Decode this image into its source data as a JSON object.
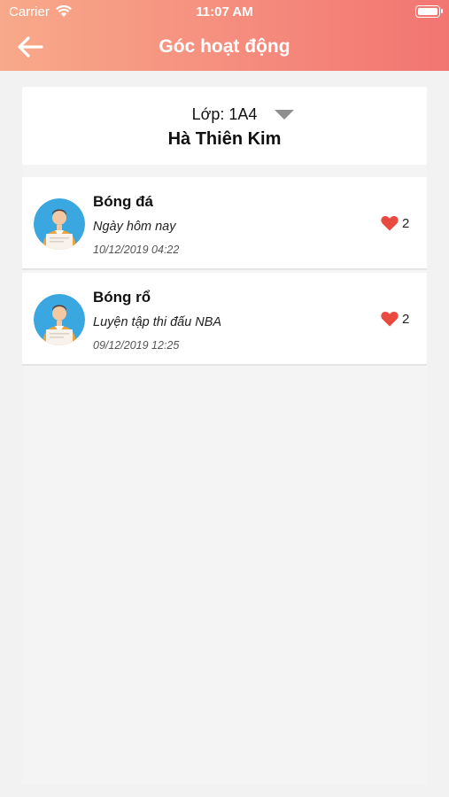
{
  "status_bar": {
    "carrier": "Carrier",
    "time": "11:07 AM"
  },
  "nav": {
    "title": "Góc hoạt động",
    "back_icon": "arrow-left-icon"
  },
  "selector": {
    "class_label": "Lớp: 1A4",
    "student_name": "Hà Thiên Kim",
    "dropdown_icon": "triangle-down-icon"
  },
  "activities": [
    {
      "title": "Bóng đá",
      "description": "Ngày hôm nay",
      "date": "10/12/2019 04:22",
      "likes": "2"
    },
    {
      "title": "Bóng rổ",
      "description": "Luyện tập thi đấu NBA",
      "date": "09/12/2019 12:25",
      "likes": "2"
    }
  ],
  "colors": {
    "header_gradient_start": "#f8a98a",
    "header_gradient_end": "#f27572",
    "heart": "#e84a3f",
    "avatar_bg": "#3aa7e0"
  }
}
